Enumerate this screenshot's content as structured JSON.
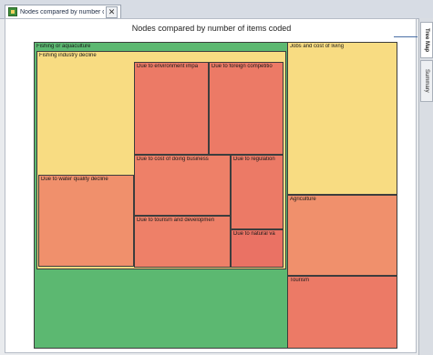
{
  "tab": {
    "label": "Nodes compared by number of",
    "close": "✕",
    "icon": "treemap-icon"
  },
  "side_tabs": [
    {
      "label": "Tree Map",
      "active": true
    },
    {
      "label": "Summary",
      "active": false
    }
  ],
  "chart_data": {
    "type": "treemap",
    "title": "Nodes compared by number of items coded",
    "colors": {
      "green": "#5cb871",
      "yellow": "#f8dc82",
      "orange": "#f0906c",
      "red": "#ec7a66"
    },
    "nodes": [
      {
        "label": "Fishing or aquaculture",
        "color": "#5cb871",
        "children": [
          {
            "label": "Fishing industry decline",
            "color": "#f8dc82",
            "children": [
              {
                "label": "Due to water quality decline",
                "color": "#f0906c"
              },
              {
                "label": "Due to environment impa",
                "color": "#ec7a66"
              },
              {
                "label": "Due to foreign competitio",
                "color": "#ec7a66"
              },
              {
                "label": "Due to cost of doing business",
                "color": "#ee8068"
              },
              {
                "label": "Due to regulation",
                "color": "#ec7a66"
              },
              {
                "label": "Due to tourism and developmen",
                "color": "#ee8068"
              },
              {
                "label": "Due to natural va",
                "color": "#ea7264"
              }
            ]
          }
        ]
      },
      {
        "label": "Jobs and cost of living",
        "color": "#f8dc82"
      },
      {
        "label": "Agriculture",
        "color": "#f0906c"
      },
      {
        "label": "Tourism",
        "color": "#ec7a66"
      }
    ]
  }
}
